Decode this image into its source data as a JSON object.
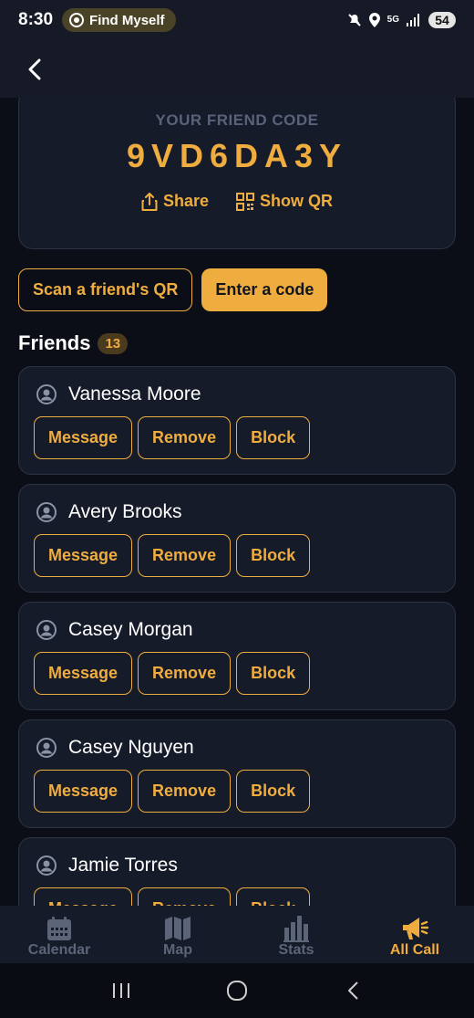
{
  "status_bar": {
    "time": "8:30",
    "app_pill": "Find Myself",
    "network": "5G",
    "battery": "54"
  },
  "app_bar": {
    "back_icon": "chevron-left-icon"
  },
  "friend_code_card": {
    "label": "YOUR FRIEND CODE",
    "code": "9VD6DA3Y",
    "share_label": "Share",
    "show_qr_label": "Show QR"
  },
  "actions": {
    "scan_label": "Scan a friend's QR",
    "enter_code_label": "Enter a code"
  },
  "friends": {
    "title": "Friends",
    "count": "13",
    "message_label": "Message",
    "remove_label": "Remove",
    "block_label": "Block",
    "items": [
      {
        "name": "Vanessa Moore"
      },
      {
        "name": "Avery Brooks"
      },
      {
        "name": "Casey Morgan"
      },
      {
        "name": "Casey Nguyen"
      },
      {
        "name": "Jamie Torres"
      }
    ]
  },
  "bottom_nav": {
    "items": [
      {
        "label": "Calendar",
        "icon": "calendar-icon"
      },
      {
        "label": "Map",
        "icon": "map-icon"
      },
      {
        "label": "Stats",
        "icon": "stats-icon"
      },
      {
        "label": "All Call",
        "icon": "megaphone-icon",
        "active": true
      }
    ]
  },
  "colors": {
    "accent": "#f0ad3f",
    "background": "#0b0e17",
    "card": "#161b29",
    "muted": "#5c6578"
  }
}
